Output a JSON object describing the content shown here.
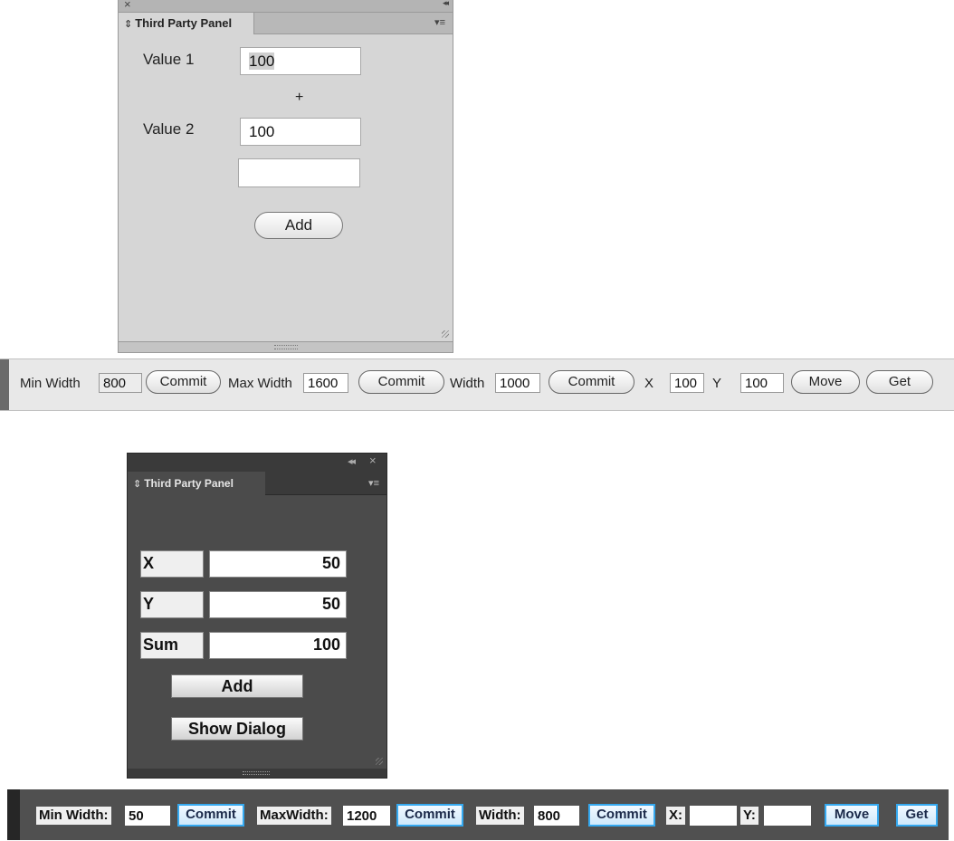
{
  "panel_light": {
    "close_glyph": "×",
    "collapse_glyph": "◂◂",
    "tab_arrows": "⇕",
    "tab_title": "Third Party Panel",
    "menu_glyph": "▾≡",
    "value1_label": "Value 1",
    "value1": "100",
    "operator": "+",
    "value2_label": "Value 2",
    "value2": "100",
    "result": "",
    "add_label": "Add"
  },
  "toolbar_light": {
    "min_width_label": "Min Width",
    "min_width_value": "800",
    "commit1": "Commit",
    "max_width_label": "Max Width",
    "max_width_value": "1600",
    "commit2": "Commit",
    "width_label": "Width",
    "width_value": "1000",
    "commit3": "Commit",
    "x_label": "X",
    "x_value": "100",
    "y_label": "Y",
    "y_value": "100",
    "move_label": "Move",
    "get_label": "Get"
  },
  "panel_dark": {
    "collapse_glyph": "◂◂",
    "close_glyph": "×",
    "tab_arrows": "⇕",
    "tab_title": "Third Party Panel",
    "menu_glyph": "▾≡",
    "x_label": "X",
    "x_value": "50",
    "y_label": "Y",
    "y_value": "50",
    "sum_label": "Sum",
    "sum_value": "100",
    "add_label": "Add",
    "show_dialog_label": "Show Dialog"
  },
  "toolbar_dark": {
    "min_width_label": "Min Width:",
    "min_width_value": "50",
    "commit1": "Commit",
    "max_width_label": "MaxWidth:",
    "max_width_value": "1200",
    "commit2": "Commit",
    "width_label": "Width:",
    "width_value": "800",
    "commit3": "Commit",
    "x_label": "X:",
    "x_value": "",
    "y_label": "Y:",
    "y_value": "",
    "move_label": "Move",
    "get_label": "Get"
  },
  "colors": {
    "light_panel_bg": "#d6d6d6",
    "dark_panel_bg": "#4b4b4b",
    "dark_toolbar_bg": "#505050",
    "button_accent_blue": "#35a9f0"
  }
}
